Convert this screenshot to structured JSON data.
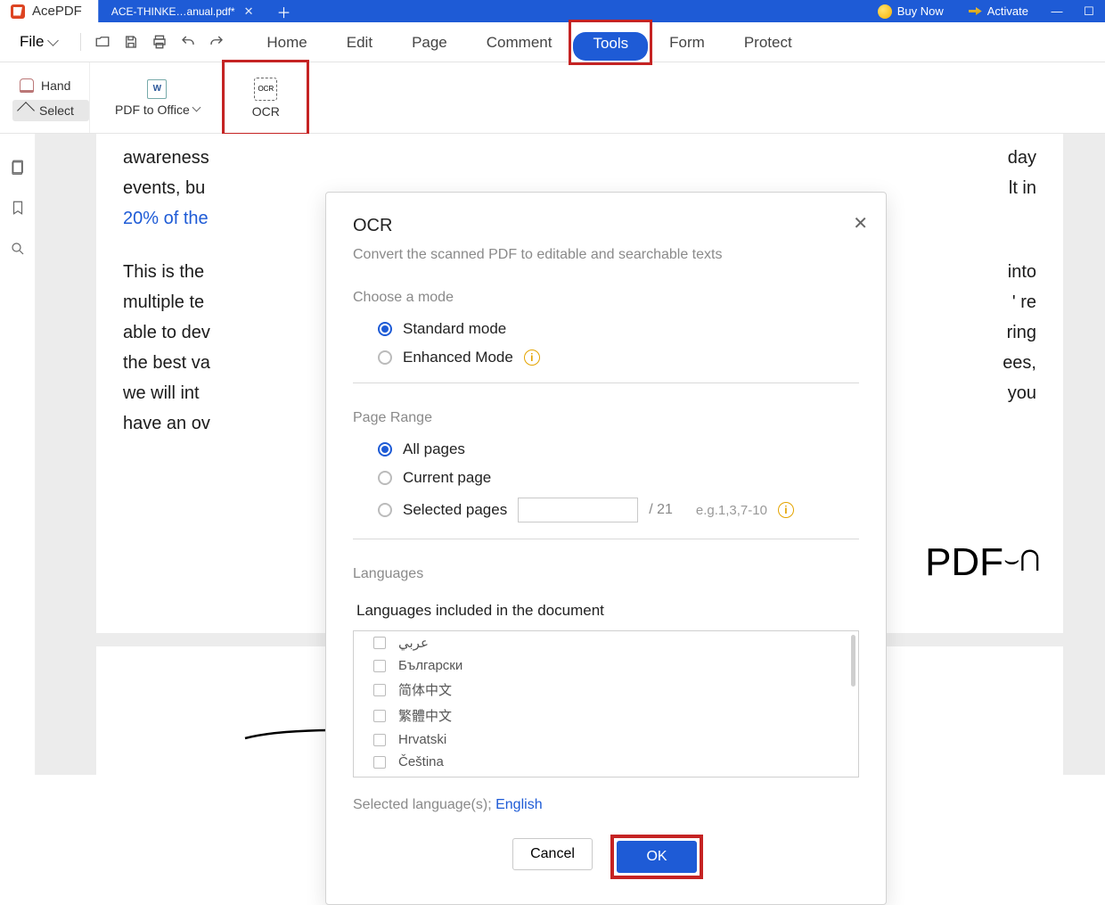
{
  "titlebar": {
    "app_name": "AcePDF",
    "doc_name": "ACE-THINKE…anual.pdf*",
    "buy_now": "Buy Now",
    "activate": "Activate"
  },
  "menubar": {
    "file": "File",
    "tabs": {
      "home": "Home",
      "edit": "Edit",
      "page": "Page",
      "comment": "Comment",
      "tools": "Tools",
      "form": "Form",
      "protect": "Protect"
    }
  },
  "ribbon": {
    "hand": "Hand",
    "select": "Select",
    "pdf_to_office": "PDF to Office",
    "ocr": "OCR"
  },
  "doc": {
    "p1a": "awareness",
    "p1b": "events, bu",
    "p1c": "20% of the",
    "p1ra": "day",
    "p1rb": "lt in",
    "p2a": "This is the",
    "p2b": "multiple te",
    "p2c": "able to dev",
    "p2d": "the best va",
    "p2e": "we will int",
    "p2f": "have an ov",
    "p2ra": "into",
    "p2rb": "' re",
    "p2rc": "ring",
    "p2rd": "ees,",
    "p2re": "you",
    "handdraw": "PDF"
  },
  "dlg": {
    "title": "OCR",
    "subtitle": "Convert the scanned PDF to editable and searchable texts",
    "choose_mode": "Choose a mode",
    "standard": "Standard mode",
    "enhanced": "Enhanced Mode",
    "page_range": "Page Range",
    "all_pages": "All pages",
    "current_page": "Current page",
    "selected_pages": "Selected pages",
    "total_pages": "/ 21",
    "example": "e.g.1,3,7-10",
    "languages": "Languages",
    "languages_title": "Languages included in the document",
    "lang_list": [
      "عربي",
      "Български",
      "简体中文",
      "繁體中文",
      "Hrvatski",
      "Čeština"
    ],
    "selected_lang_label": "Selected language(s); ",
    "selected_lang": "English",
    "cancel": "Cancel",
    "ok": "OK"
  }
}
